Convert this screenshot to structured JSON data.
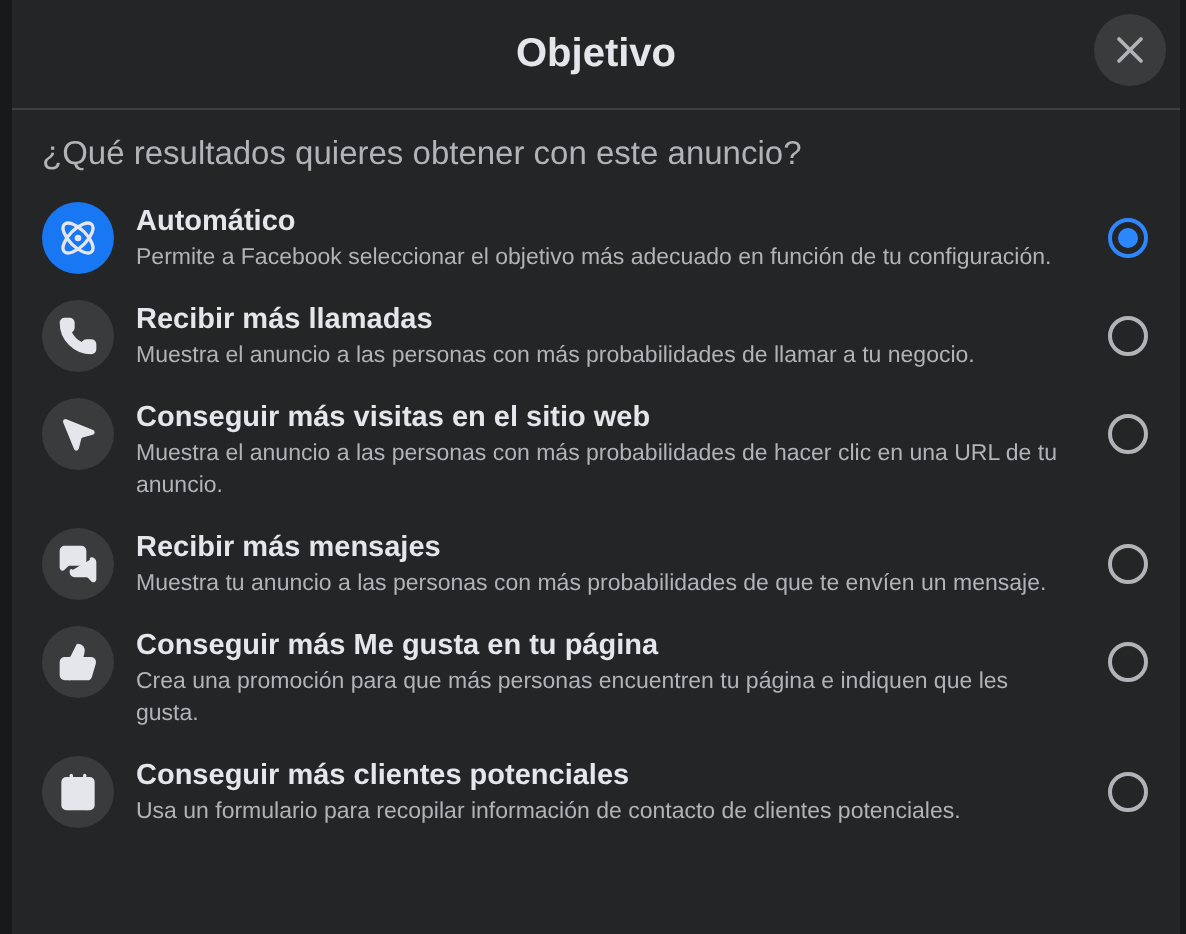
{
  "dialog": {
    "title": "Objetivo",
    "question": "¿Qué resultados quieres obtener con este anuncio?",
    "options": [
      {
        "kind": "atom",
        "title": "Automático",
        "description": "Permite a Facebook seleccionar el objetivo más adecuado en función de tu configuración.",
        "selected": true
      },
      {
        "kind": "phone",
        "title": "Recibir más llamadas",
        "description": "Muestra el anuncio a las personas con más probabilidades de llamar a tu negocio.",
        "selected": false
      },
      {
        "kind": "cursor",
        "title": "Conseguir más visitas en el sitio web",
        "description": "Muestra el anuncio a las personas con más probabilidades de hacer clic en una URL de tu anuncio.",
        "selected": false
      },
      {
        "kind": "chat",
        "title": "Recibir más mensajes",
        "description": "Muestra tu anuncio a las personas con más probabilidades de que te envíen un mensaje.",
        "selected": false
      },
      {
        "kind": "like",
        "title": "Conseguir más Me gusta en tu página",
        "description": "Crea una promoción para que más personas encuentren tu página e indiquen que les gusta.",
        "selected": false
      },
      {
        "kind": "contact",
        "title": "Conseguir más clientes potenciales",
        "description": "Usa un formulario para recopilar información de contacto de clientes potenciales.",
        "selected": false
      }
    ]
  }
}
